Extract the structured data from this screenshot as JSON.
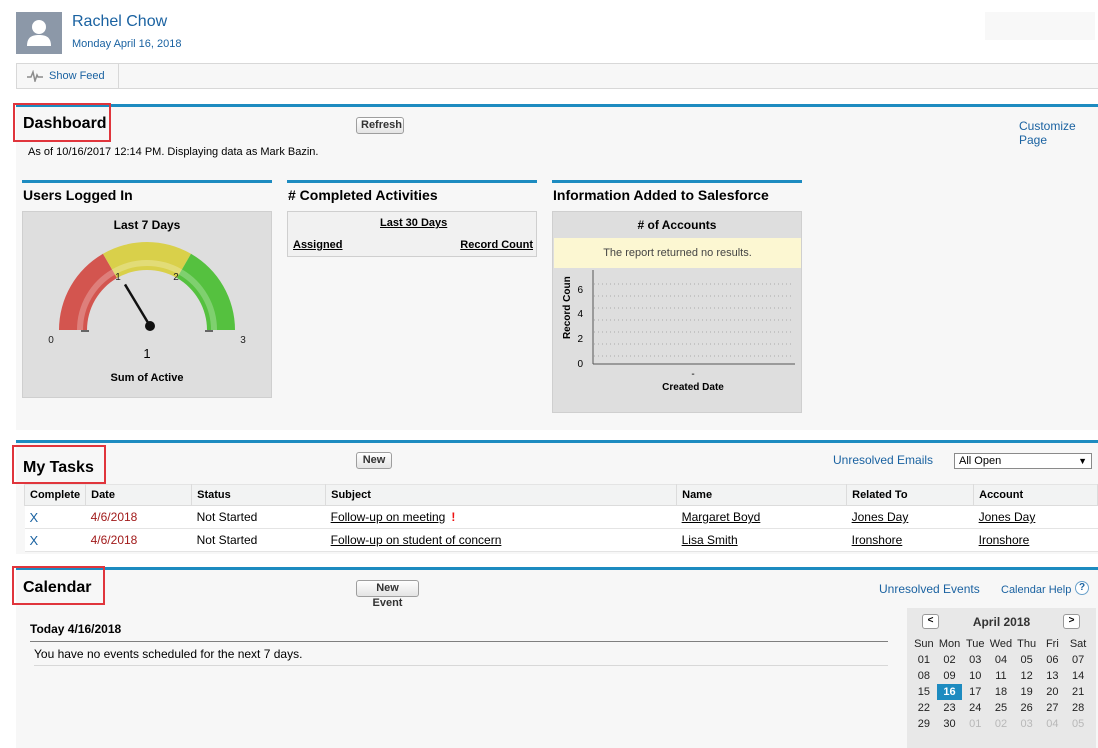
{
  "header": {
    "user_name": "Rachel Chow",
    "date": "Monday April 16, 2018"
  },
  "feed": {
    "show_feed_label": "Show Feed"
  },
  "dashboard": {
    "title": "Dashboard",
    "refresh_label": "Refresh",
    "customize_label": "Customize Page",
    "as_of": "As of 10/16/2017 12:14 PM. Displaying data as Mark Bazin.",
    "components": {
      "users": {
        "title": "Users Logged In",
        "subtitle": "Last 7 Days",
        "footer": "Sum of Active",
        "value": "1",
        "ticks": [
          "0",
          "1",
          "2",
          "3"
        ]
      },
      "activities": {
        "title": "# Completed Activities",
        "period": "Last 30 Days",
        "col_assigned": "Assigned",
        "col_record_count": "Record Count"
      },
      "info": {
        "title": "Information Added to Salesforce",
        "chart_title": "# of Accounts",
        "no_results": "The report returned no results.",
        "ylabel": "Record Count",
        "xlabel": "Created Date",
        "x_tick": "-",
        "y_ticks": [
          "0",
          "2",
          "4",
          "6"
        ]
      }
    }
  },
  "chart_data": {
    "type": "gauge",
    "title": "Last 7 Days",
    "xlabel": "Sum of Active",
    "value": 1,
    "range": [
      0,
      3
    ],
    "bands": [
      {
        "from": 0,
        "to": 1,
        "color": "#d3554f"
      },
      {
        "from": 1,
        "to": 2,
        "color": "#d9d04a"
      },
      {
        "from": 2,
        "to": 3,
        "color": "#55c13f"
      }
    ]
  },
  "tasks": {
    "title": "My Tasks",
    "new_label": "New",
    "unresolved_emails": "Unresolved Emails",
    "filter_value": "All Open",
    "columns": [
      "Complete",
      "Date",
      "Status",
      "Subject",
      "Name",
      "Related To",
      "Account"
    ],
    "rows": [
      {
        "complete": "X",
        "date": "4/6/2018",
        "status": "Not Started",
        "subject": "Follow-up on meeting",
        "flag": "!",
        "name": "Margaret Boyd",
        "related": "Jones Day",
        "account": "Jones Day"
      },
      {
        "complete": "X",
        "date": "4/6/2018",
        "status": "Not Started",
        "subject": "Follow-up on student of concern",
        "flag": "",
        "name": "Lisa Smith",
        "related": "Ironshore",
        "account": "Ironshore"
      }
    ]
  },
  "calendar": {
    "title": "Calendar",
    "new_event_label": "New Event",
    "unresolved_events": "Unresolved Events",
    "help_label": "Calendar Help",
    "help_icon": "?",
    "today_header": "Today 4/16/2018",
    "today_message": "You have no events scheduled for the next 7 days.",
    "mini": {
      "month": "April 2018",
      "prev": "<",
      "next": ">",
      "weekdays": [
        "Sun",
        "Mon",
        "Tue",
        "Wed",
        "Thu",
        "Fri",
        "Sat"
      ],
      "weeks": [
        [
          "01",
          "02",
          "03",
          "04",
          "05",
          "06",
          "07"
        ],
        [
          "08",
          "09",
          "10",
          "11",
          "12",
          "13",
          "14"
        ],
        [
          "15",
          "16",
          "17",
          "18",
          "19",
          "20",
          "21"
        ],
        [
          "22",
          "23",
          "24",
          "25",
          "26",
          "27",
          "28"
        ],
        [
          "29",
          "30",
          "01",
          "02",
          "03",
          "04",
          "05"
        ]
      ],
      "today": "16"
    }
  },
  "colors": {
    "accent": "#1d8bc0",
    "link": "#1a62a1",
    "highlight_box": "#e0353c",
    "date_red": "#a11a1a"
  },
  "icons": {
    "avatar": "user-silhouette-icon",
    "feed": "pulse-icon",
    "flag": "exclamation-icon",
    "help": "help-icon"
  }
}
